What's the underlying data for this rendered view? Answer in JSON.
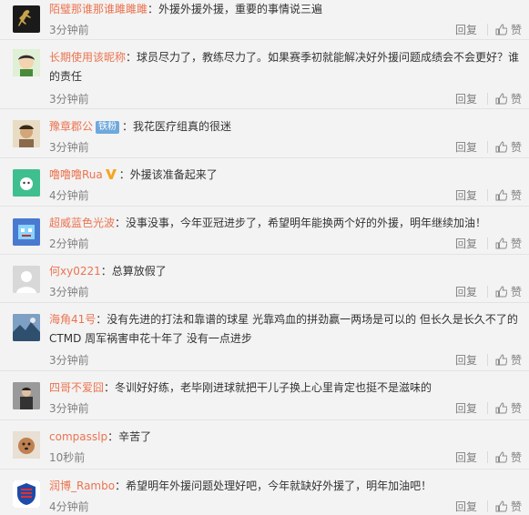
{
  "ui": {
    "reply": "回复",
    "like": "赞"
  },
  "comments": [
    {
      "user": "陌璧那谁那谁雎雎雎",
      "text": "：外援外援外援，重要的事情说三遍",
      "time": "3分钟前",
      "avatar_color": "#1a1a1a"
    },
    {
      "user": "长期使用该昵称",
      "text": "：球员尽力了，教练尽力了。如果赛季初就能解决好外援问题成绩会不会更好？谁的责任",
      "time": "3分钟前",
      "avatar_color": "#5b9e4a"
    },
    {
      "user": "豫章郡公",
      "badge": "铁粉",
      "text": "：我花医疗组真的很迷",
      "time": "3分钟前",
      "avatar_color": "#c9b38b"
    },
    {
      "user": "噜噜噜Rua",
      "text": "：外援该准备起来了",
      "time": "4分钟前",
      "avatar_color": "#3fbf8f"
    },
    {
      "user": "超威蓝色光波",
      "text": "：没事没事，今年亚冠进步了，希望明年能换两个好的外援，明年继续加油！",
      "time": "2分钟前",
      "avatar_color": "#6a4fb3"
    },
    {
      "user": "何xy0221",
      "text": "：总算放假了",
      "time": "3分钟前",
      "avatar_color": "#cfcfcf"
    },
    {
      "user": "海角41号",
      "text": "：没有先进的打法和靠谱的球星 光靠鸡血的拼劲赢一两场是可以的 但长久是长久不了的 CTMD 周军祸害申花十年了 没有一点进步",
      "time": "3分钟前",
      "avatar_color": "#3b5f8a"
    },
    {
      "user": "四哥不爱囧",
      "text": "：冬训好好练，老毕刚进球就把干儿子换上心里肯定也挺不是滋味的",
      "time": "3分钟前",
      "avatar_color": "#5a5a5a"
    },
    {
      "user": "compasslp",
      "text": "：辛苦了",
      "time": "10秒前",
      "avatar_color": "#b5784a"
    },
    {
      "user": "润博_Rambo",
      "text": "：希望明年外援问题处理好吧，今年就缺好外援了，明年加油吧！",
      "time": "4分钟前",
      "avatar_color": "#1e4aa8"
    }
  ]
}
